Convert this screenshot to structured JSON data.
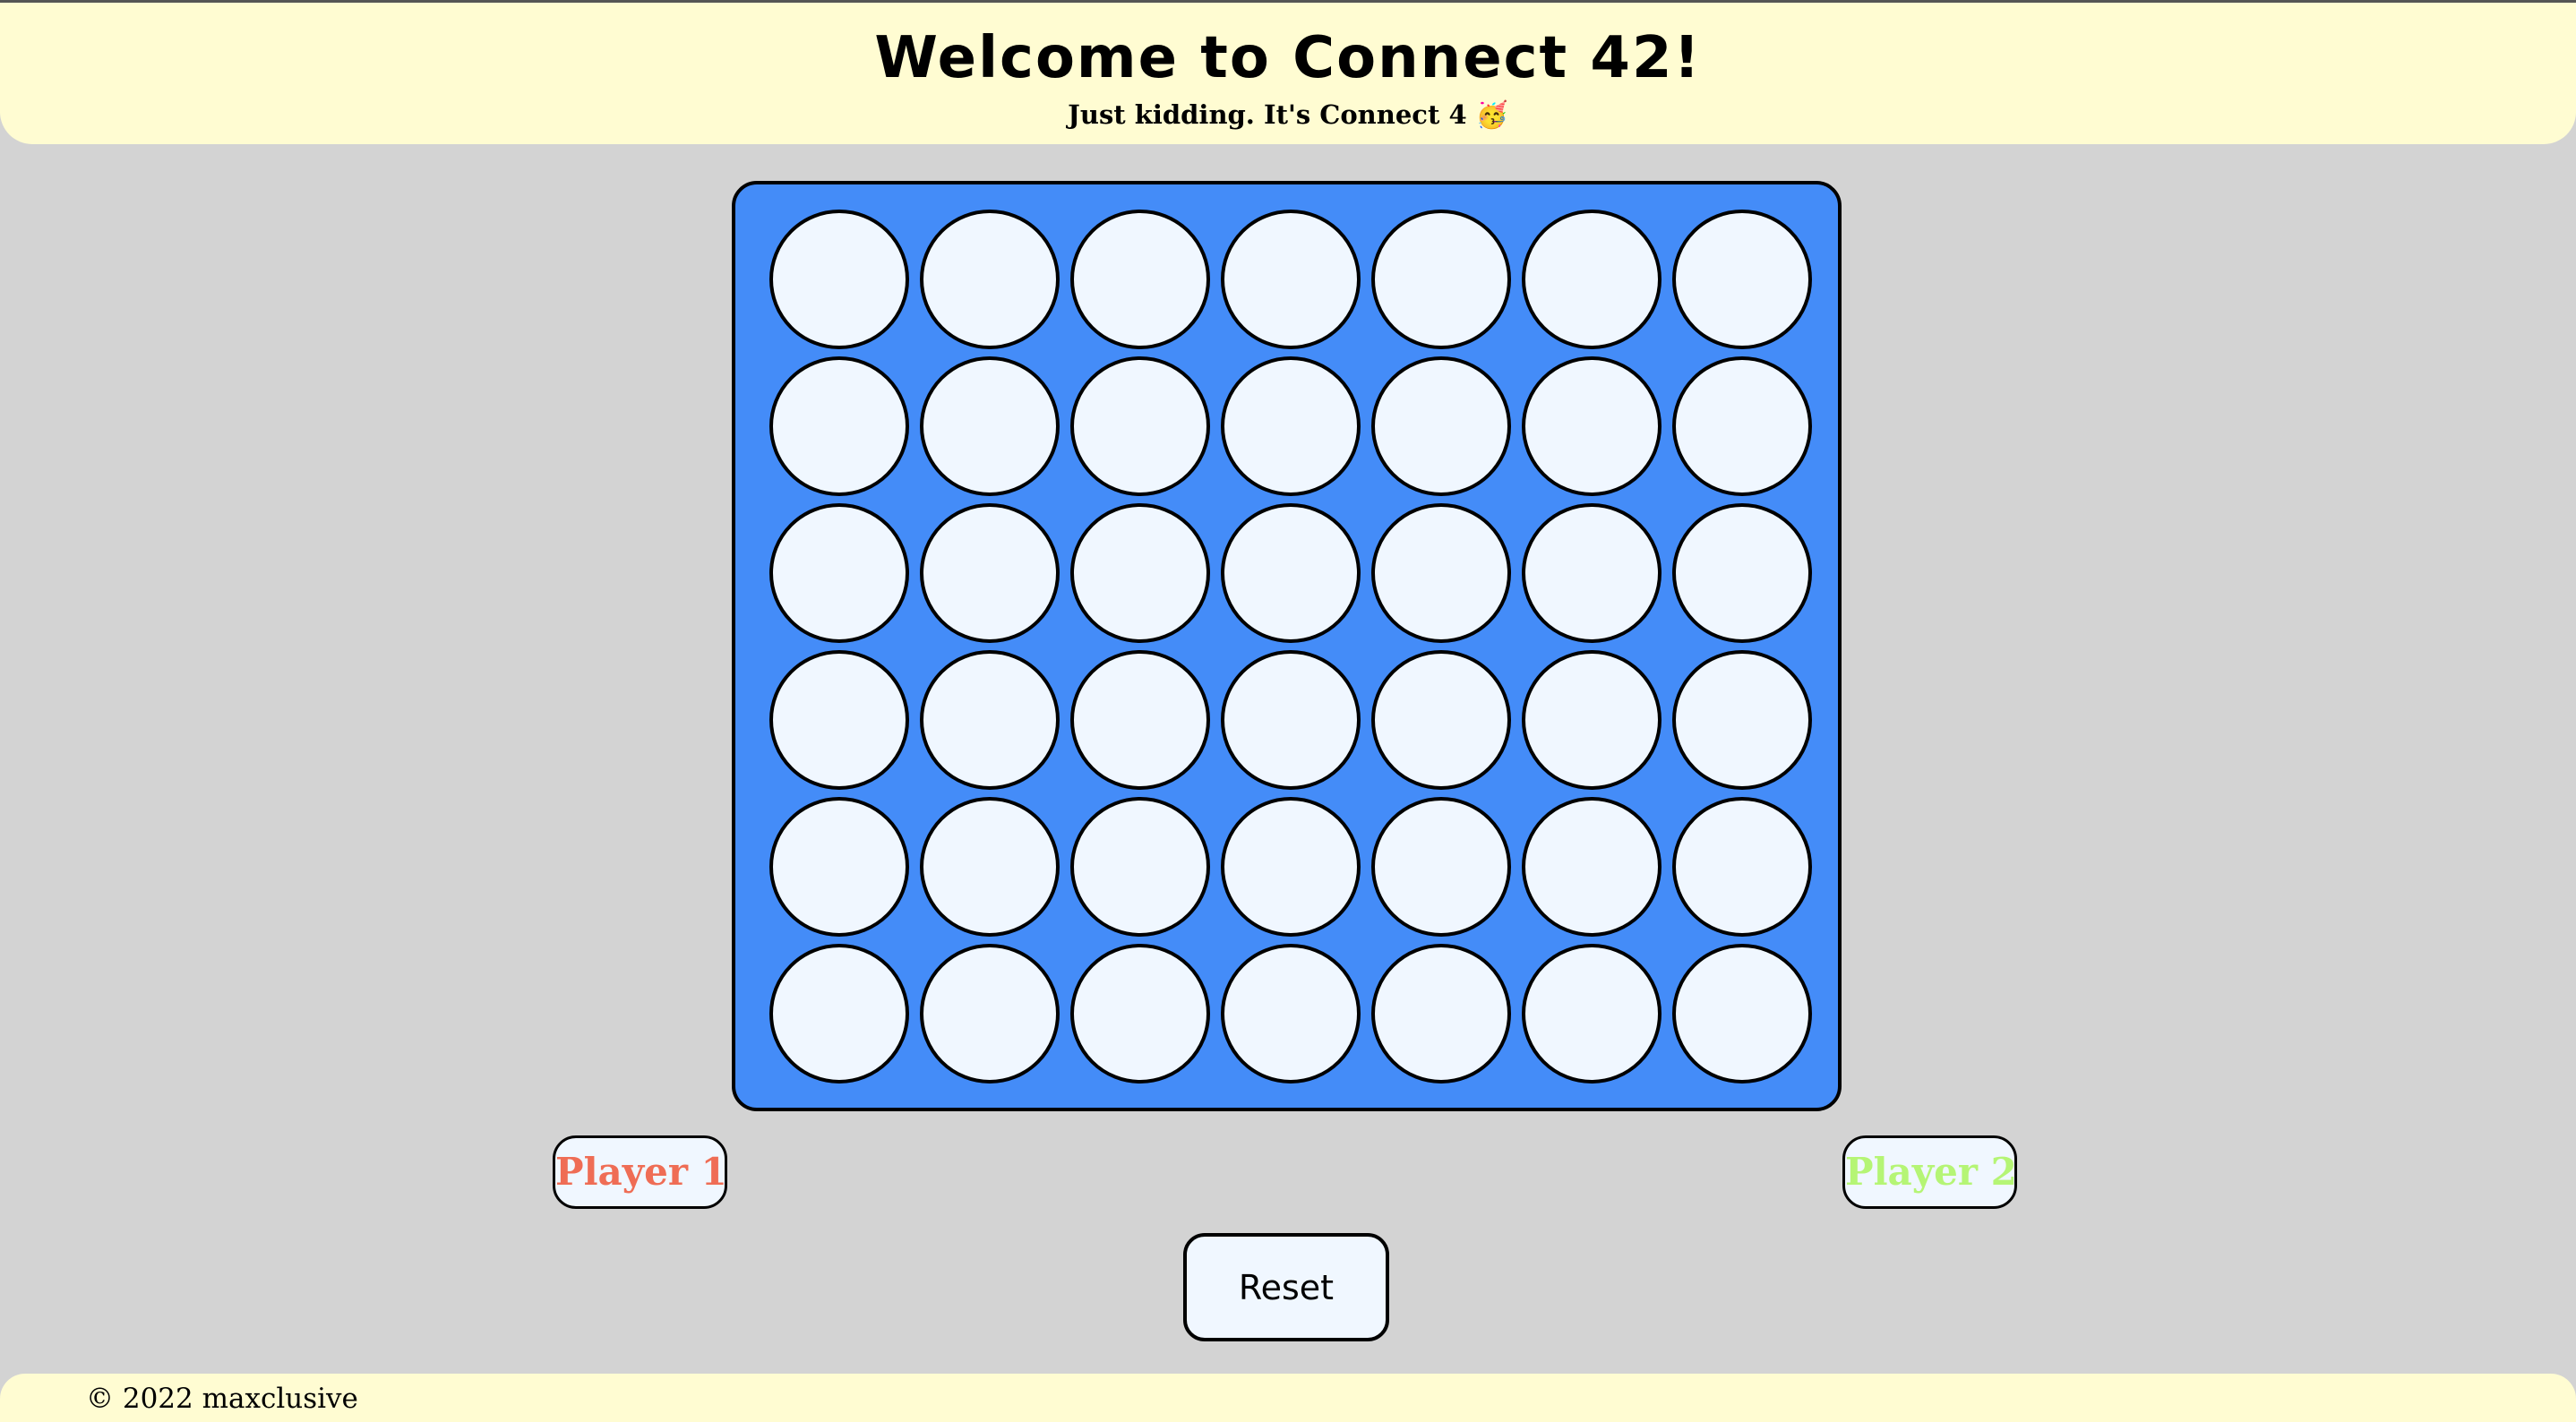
{
  "header": {
    "title": "Welcome to Connect 42!",
    "subtitle": "Just kidding. It's Connect 4 🥳"
  },
  "board": {
    "rows": 6,
    "columns": 7,
    "board_color": "#448cf8",
    "empty_cell_color": "#f0f7ff",
    "cells": [
      [
        "empty",
        "empty",
        "empty",
        "empty",
        "empty",
        "empty",
        "empty"
      ],
      [
        "empty",
        "empty",
        "empty",
        "empty",
        "empty",
        "empty",
        "empty"
      ],
      [
        "empty",
        "empty",
        "empty",
        "empty",
        "empty",
        "empty",
        "empty"
      ],
      [
        "empty",
        "empty",
        "empty",
        "empty",
        "empty",
        "empty",
        "empty"
      ],
      [
        "empty",
        "empty",
        "empty",
        "empty",
        "empty",
        "empty",
        "empty"
      ],
      [
        "empty",
        "empty",
        "empty",
        "empty",
        "empty",
        "empty",
        "empty"
      ]
    ]
  },
  "players": {
    "player1": {
      "label": "Player 1",
      "color": "#ef6d55"
    },
    "player2": {
      "label": "Player 2",
      "color": "#b5f575"
    }
  },
  "controls": {
    "reset_label": "Reset"
  },
  "footer": {
    "copyright": "© 2022 maxclusive"
  }
}
